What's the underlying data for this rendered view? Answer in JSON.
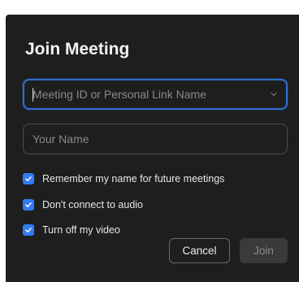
{
  "dialog": {
    "title": "Join Meeting",
    "meeting_field": {
      "placeholder": "Meeting ID or Personal Link Name",
      "value": ""
    },
    "name_field": {
      "placeholder": "Your Name",
      "value": ""
    },
    "options": [
      {
        "label": "Remember my name for future meetings",
        "checked": true
      },
      {
        "label": "Don't connect to audio",
        "checked": true
      },
      {
        "label": "Turn off my video",
        "checked": true
      }
    ],
    "buttons": {
      "cancel_label": "Cancel",
      "join_label": "Join"
    }
  },
  "colors": {
    "background": "#1e1e1e",
    "accent": "#2f7cf6",
    "focus_border": "#2f6ed6",
    "disabled_button": "#3a3a3a"
  },
  "icons": {
    "dropdown": "chevron-down-icon",
    "check": "check-icon"
  }
}
